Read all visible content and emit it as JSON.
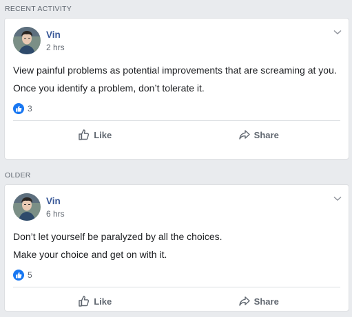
{
  "sections": [
    {
      "header": "RECENT ACTIVITY",
      "post": {
        "author": "Vin",
        "time": "2 hrs",
        "paragraphs": [
          "View painful problems as potential improvements that are screaming at you.",
          "Once you identify a problem, don’t tolerate it."
        ],
        "like_count": "3",
        "like_label": "Like",
        "share_label": "Share"
      }
    },
    {
      "header": "OLDER",
      "post": {
        "author": "Vin",
        "time": "6 hrs",
        "paragraphs": [
          "Don’t let yourself be paralyzed by all the choices.",
          "Make your choice and get on with it."
        ],
        "like_count": "5",
        "like_label": "Like",
        "share_label": "Share"
      }
    }
  ],
  "colors": {
    "background": "#e9ebee",
    "author": "#385898",
    "like_blue": "#1877f2"
  },
  "icons": {
    "like": "thumbs-up-icon",
    "share": "share-arrow-icon",
    "menu": "chevron-down-icon",
    "reaction": "like-reaction-icon"
  }
}
